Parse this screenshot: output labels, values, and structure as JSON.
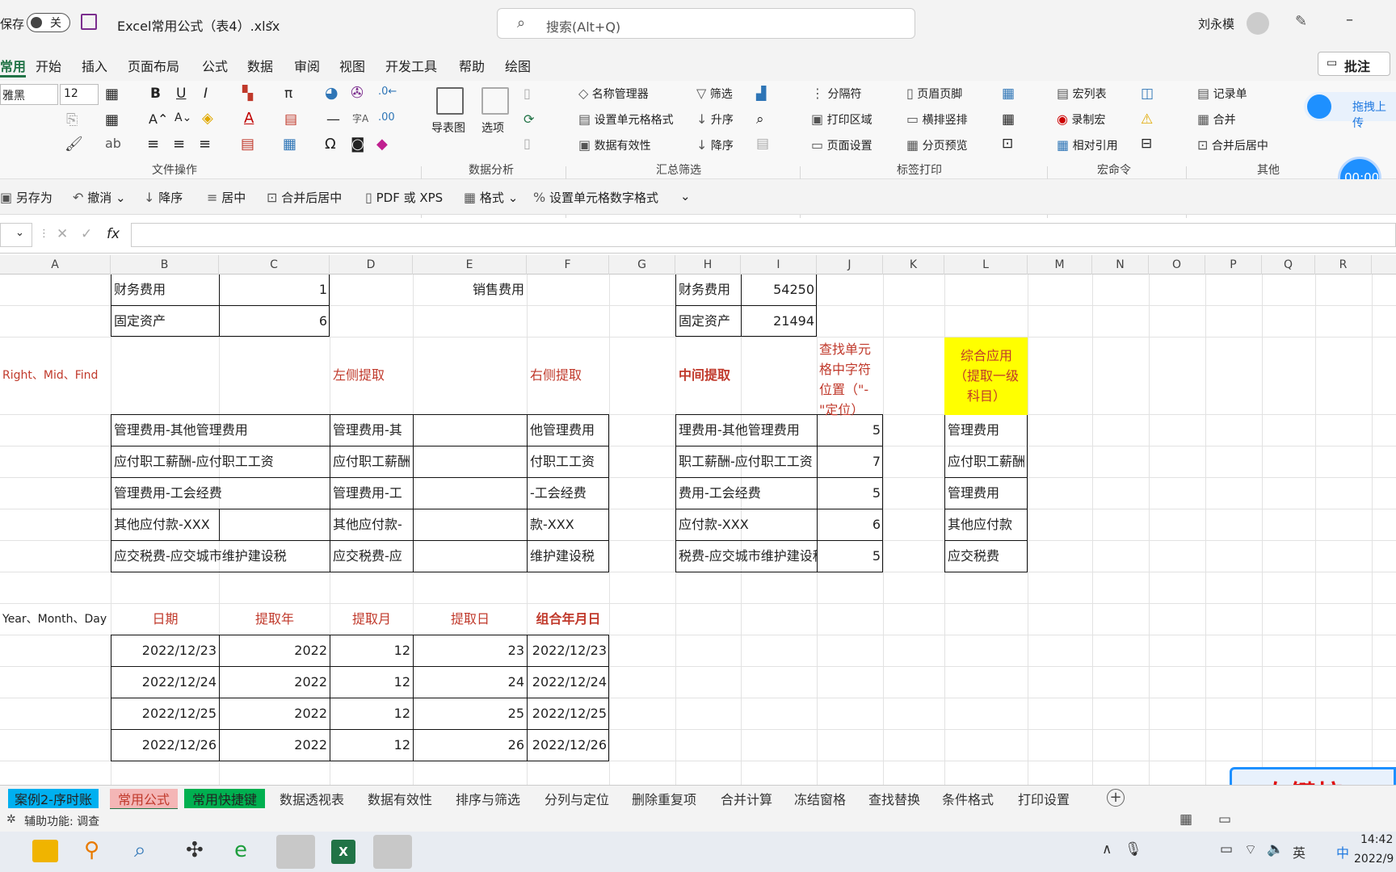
{
  "titlebar": {
    "autosave_label": "保存",
    "autosave_state": "关",
    "filename": "Excel常用公式（表4）.xlsx",
    "search_placeholder": "搜索(Alt+Q)",
    "user": "刘永模"
  },
  "menu_tabs": [
    "常用",
    "开始",
    "插入",
    "页面布局",
    "公式",
    "数据",
    "审阅",
    "视图",
    "开发工具",
    "帮助",
    "绘图"
  ],
  "comment_button": "批注",
  "ribbon": {
    "font_name": "雅黑",
    "font_size": "12",
    "groups": [
      "文件操作",
      "数据分析",
      "汇总筛选",
      "标签打印",
      "宏命令",
      "其他"
    ],
    "data_analysis": {
      "nav": "导表图",
      "options": "选项"
    },
    "summary": {
      "name_mgr": "名称管理器",
      "cell_format": "设置单元格格式",
      "validity": "数据有效性",
      "filter": "筛选",
      "asc": "升序",
      "desc": "降序"
    },
    "print": {
      "separator": "分隔符",
      "print_area": "打印区域",
      "page_setup": "页面设置",
      "header_footer": "页眉页脚",
      "orientation": "横排竖排",
      "page_preview": "分页预览"
    },
    "macro": {
      "macro_list": "宏列表",
      "record": "录制宏",
      "relative": "相对引用"
    },
    "other": {
      "record_sheet": "记录单",
      "merge": "合并",
      "merge_center": "合并后居中"
    },
    "upload_hint": "拖拽上传",
    "timer": "00:00"
  },
  "qat": [
    "另存为",
    "撤消",
    "降序",
    "居中",
    "合并后居中",
    "PDF 或 XPS",
    "格式",
    "设置单元格数字格式"
  ],
  "formula_bar": {
    "fx": "fx",
    "value": ""
  },
  "columns": [
    "A",
    "B",
    "C",
    "D",
    "E",
    "F",
    "G",
    "H",
    "I",
    "J",
    "K",
    "L",
    "M",
    "N",
    "O",
    "P",
    "Q",
    "R"
  ],
  "cells": {
    "b1": "财务费用",
    "c1": "1",
    "e1": "销售费用",
    "h1": "财务费用",
    "i1": "54250",
    "b2": "固定资产",
    "c2": "6",
    "h2": "固定资产",
    "i2": "21494",
    "a3": "Right、Mid、Find",
    "d3": "左侧提取",
    "f3": "右侧提取",
    "h3": "中间提取",
    "j3": "查找单元格中字符位置（\"-\"定位）",
    "l3": "综合应用（提取一级科目）",
    "rows": [
      {
        "b": "管理费用-其他管理费用",
        "d": "管理费用-其",
        "f": "他管理费用",
        "h": "理费用-其他管理费用",
        "j": "5",
        "l": "管理费用"
      },
      {
        "b": "应付职工薪酬-应付职工工资",
        "d": "应付职工薪酬",
        "f": "付职工工资",
        "h": "职工薪酬-应付职工工资",
        "j": "7",
        "l": "应付职工薪酬"
      },
      {
        "b": "管理费用-工会经费",
        "d": "管理费用-工",
        "f": "-工会经费",
        "h": "费用-工会经费",
        "j": "5",
        "l": "管理费用"
      },
      {
        "b": "其他应付款-XXX",
        "d": "其他应付款-",
        "f": "款-XXX",
        "h": "应付款-XXX",
        "j": "6",
        "l": "其他应付款"
      },
      {
        "b": "应交税费-应交城市维护建设税",
        "d": "应交税费-应",
        "f": "维护建设税",
        "h": "税费-应交城市维护建设税",
        "j": "5",
        "l": "应交税费"
      }
    ],
    "a10": "Year、Month、Day",
    "date_headers": [
      "日期",
      "提取年",
      "提取月",
      "提取日",
      "组合年月日"
    ],
    "dates": [
      [
        "2022/12/23",
        "2022",
        "12",
        "23",
        "2022/12/23"
      ],
      [
        "2022/12/24",
        "2022",
        "12",
        "24",
        "2022/12/24"
      ],
      [
        "2022/12/25",
        "2022",
        "12",
        "25",
        "2022/12/25"
      ],
      [
        "2022/12/26",
        "2022",
        "12",
        "26",
        "2022/12/26"
      ]
    ]
  },
  "sheet_tabs": [
    "案例2-序时账",
    "常用公式",
    "常用快捷键",
    "数据透视表",
    "数据有效性",
    "排序与筛选",
    "分列与定位",
    "删除重复项",
    "合并计算",
    "冻结窗格",
    "查找替换",
    "条件格式",
    "打印设置"
  ],
  "status": {
    "accessibility": "辅助功能: 调查"
  },
  "overlay_text": "<左键按",
  "taskbar": {
    "ime": "英",
    "ime2": "中",
    "time": "14:42",
    "date": "2022/9"
  },
  "colors": {
    "red_text": "#c0392b",
    "yellow_fill": "#ffff00",
    "excel_green": "#217346",
    "tab_blue": "#00b0f0",
    "tab_pink": "#f4b6b6",
    "tab_green": "#00b050"
  }
}
